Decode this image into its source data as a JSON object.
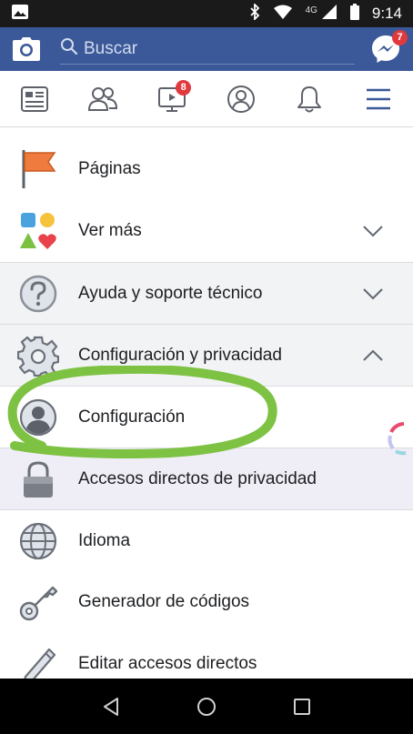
{
  "status_bar": {
    "time": "9:14",
    "network": "4G",
    "icons": [
      "image-icon",
      "bluetooth-icon",
      "wifi-icon",
      "signal-icon",
      "battery-icon"
    ]
  },
  "header": {
    "search_placeholder": "Buscar",
    "messenger_badge": "7",
    "color": "#3b5998"
  },
  "tabs": [
    {
      "name": "news-feed-icon"
    },
    {
      "name": "friends-icon"
    },
    {
      "name": "watch-icon",
      "badge": "8"
    },
    {
      "name": "profile-icon"
    },
    {
      "name": "notifications-icon"
    },
    {
      "name": "menu-icon"
    }
  ],
  "menu": {
    "paginas": "Páginas",
    "ver_mas": "Ver más",
    "ayuda": "Ayuda y soporte técnico",
    "config_privacidad": "Configuración y privacidad",
    "configuracion": "Configuración",
    "accesos_privacidad": "Accesos directos de privacidad",
    "idioma": "Idioma",
    "generador": "Generador de códigos",
    "editar_accesos": "Editar accesos directos"
  },
  "annotation_color": "#7dc242"
}
